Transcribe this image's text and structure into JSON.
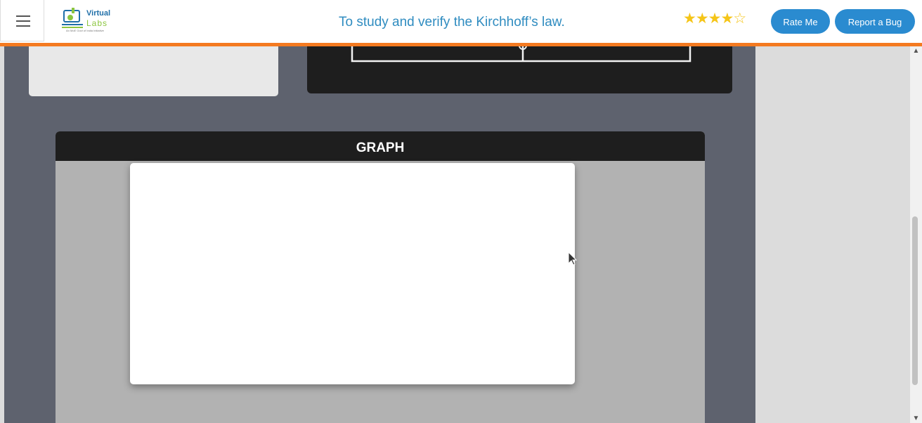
{
  "header": {
    "logo": {
      "line1": "Virtual",
      "line2": "Labs",
      "tagline": "An MoE Govt of India Initiative"
    },
    "title": "To study and verify the Kirchhoff’s law.",
    "rating": {
      "value": 4,
      "max": 5,
      "filled_star": "★",
      "empty_star": "☆"
    },
    "rate_button": "Rate Me",
    "bug_button": "Report a Bug"
  },
  "graph": {
    "heading": "GRAPH"
  },
  "colors": {
    "accent_orange": "#f47a20",
    "button_blue": "#2a8bd0",
    "title_blue": "#2f8cc0",
    "panel_dark": "#1e1e1e",
    "main_bg": "#5e626e"
  },
  "icons": {
    "menu": "hamburger-menu-icon",
    "star": "star-icon",
    "scroll_up": "chevron-up-icon",
    "scroll_down": "chevron-down-icon",
    "cursor": "mouse-pointer-icon"
  }
}
